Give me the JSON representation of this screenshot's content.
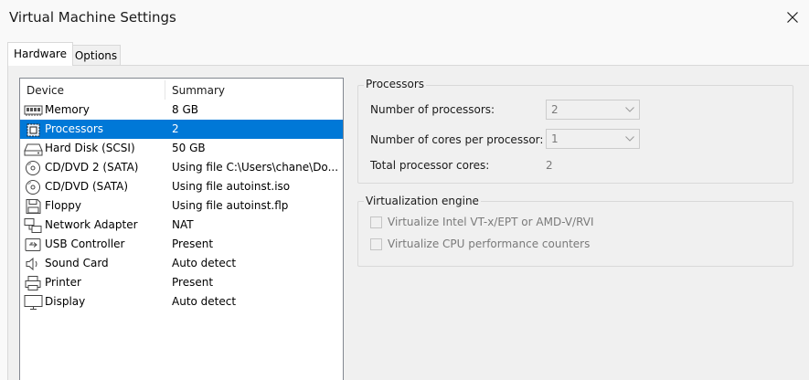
{
  "window": {
    "title": "Virtual Machine Settings"
  },
  "tabs": [
    {
      "label": "Hardware",
      "active": true
    },
    {
      "label": "Options",
      "active": false
    }
  ],
  "device_list": {
    "headers": {
      "device": "Device",
      "summary": "Summary"
    },
    "selected": "Processors",
    "rows": [
      {
        "name": "Memory",
        "summary": "8 GB",
        "icon": "memory-icon"
      },
      {
        "name": "Processors",
        "summary": "2",
        "icon": "processor-icon"
      },
      {
        "name": "Hard Disk (SCSI)",
        "summary": "50 GB",
        "icon": "hard-disk-icon"
      },
      {
        "name": "CD/DVD 2 (SATA)",
        "summary": "Using file C:\\Users\\chane\\Do...",
        "icon": "cd-dvd-icon"
      },
      {
        "name": "CD/DVD (SATA)",
        "summary": "Using file autoinst.iso",
        "icon": "cd-dvd-icon"
      },
      {
        "name": "Floppy",
        "summary": "Using file autoinst.flp",
        "icon": "floppy-icon"
      },
      {
        "name": "Network Adapter",
        "summary": "NAT",
        "icon": "network-adapter-icon"
      },
      {
        "name": "USB Controller",
        "summary": "Present",
        "icon": "usb-controller-icon"
      },
      {
        "name": "Sound Card",
        "summary": "Auto detect",
        "icon": "sound-card-icon"
      },
      {
        "name": "Printer",
        "summary": "Present",
        "icon": "printer-icon"
      },
      {
        "name": "Display",
        "summary": "Auto detect",
        "icon": "display-icon"
      }
    ]
  },
  "processors": {
    "group_title": "Processors",
    "num_processors_label": "Number of processors:",
    "num_processors_value": "2",
    "cores_per_processor_label": "Number of cores per processor:",
    "cores_per_processor_value": "1",
    "total_cores_label": "Total processor cores:",
    "total_cores_value": "2"
  },
  "virtualization": {
    "group_title": "Virtualization engine",
    "options": [
      {
        "label": "Virtualize Intel VT-x/EPT or AMD-V/RVI",
        "checked": false,
        "enabled": false
      },
      {
        "label": "Virtualize CPU performance counters",
        "checked": false,
        "enabled": false
      }
    ]
  },
  "colors": {
    "selection": "#0078d7",
    "window_bg": "#f0f0f0",
    "disabled_text": "#7a7a7a"
  }
}
